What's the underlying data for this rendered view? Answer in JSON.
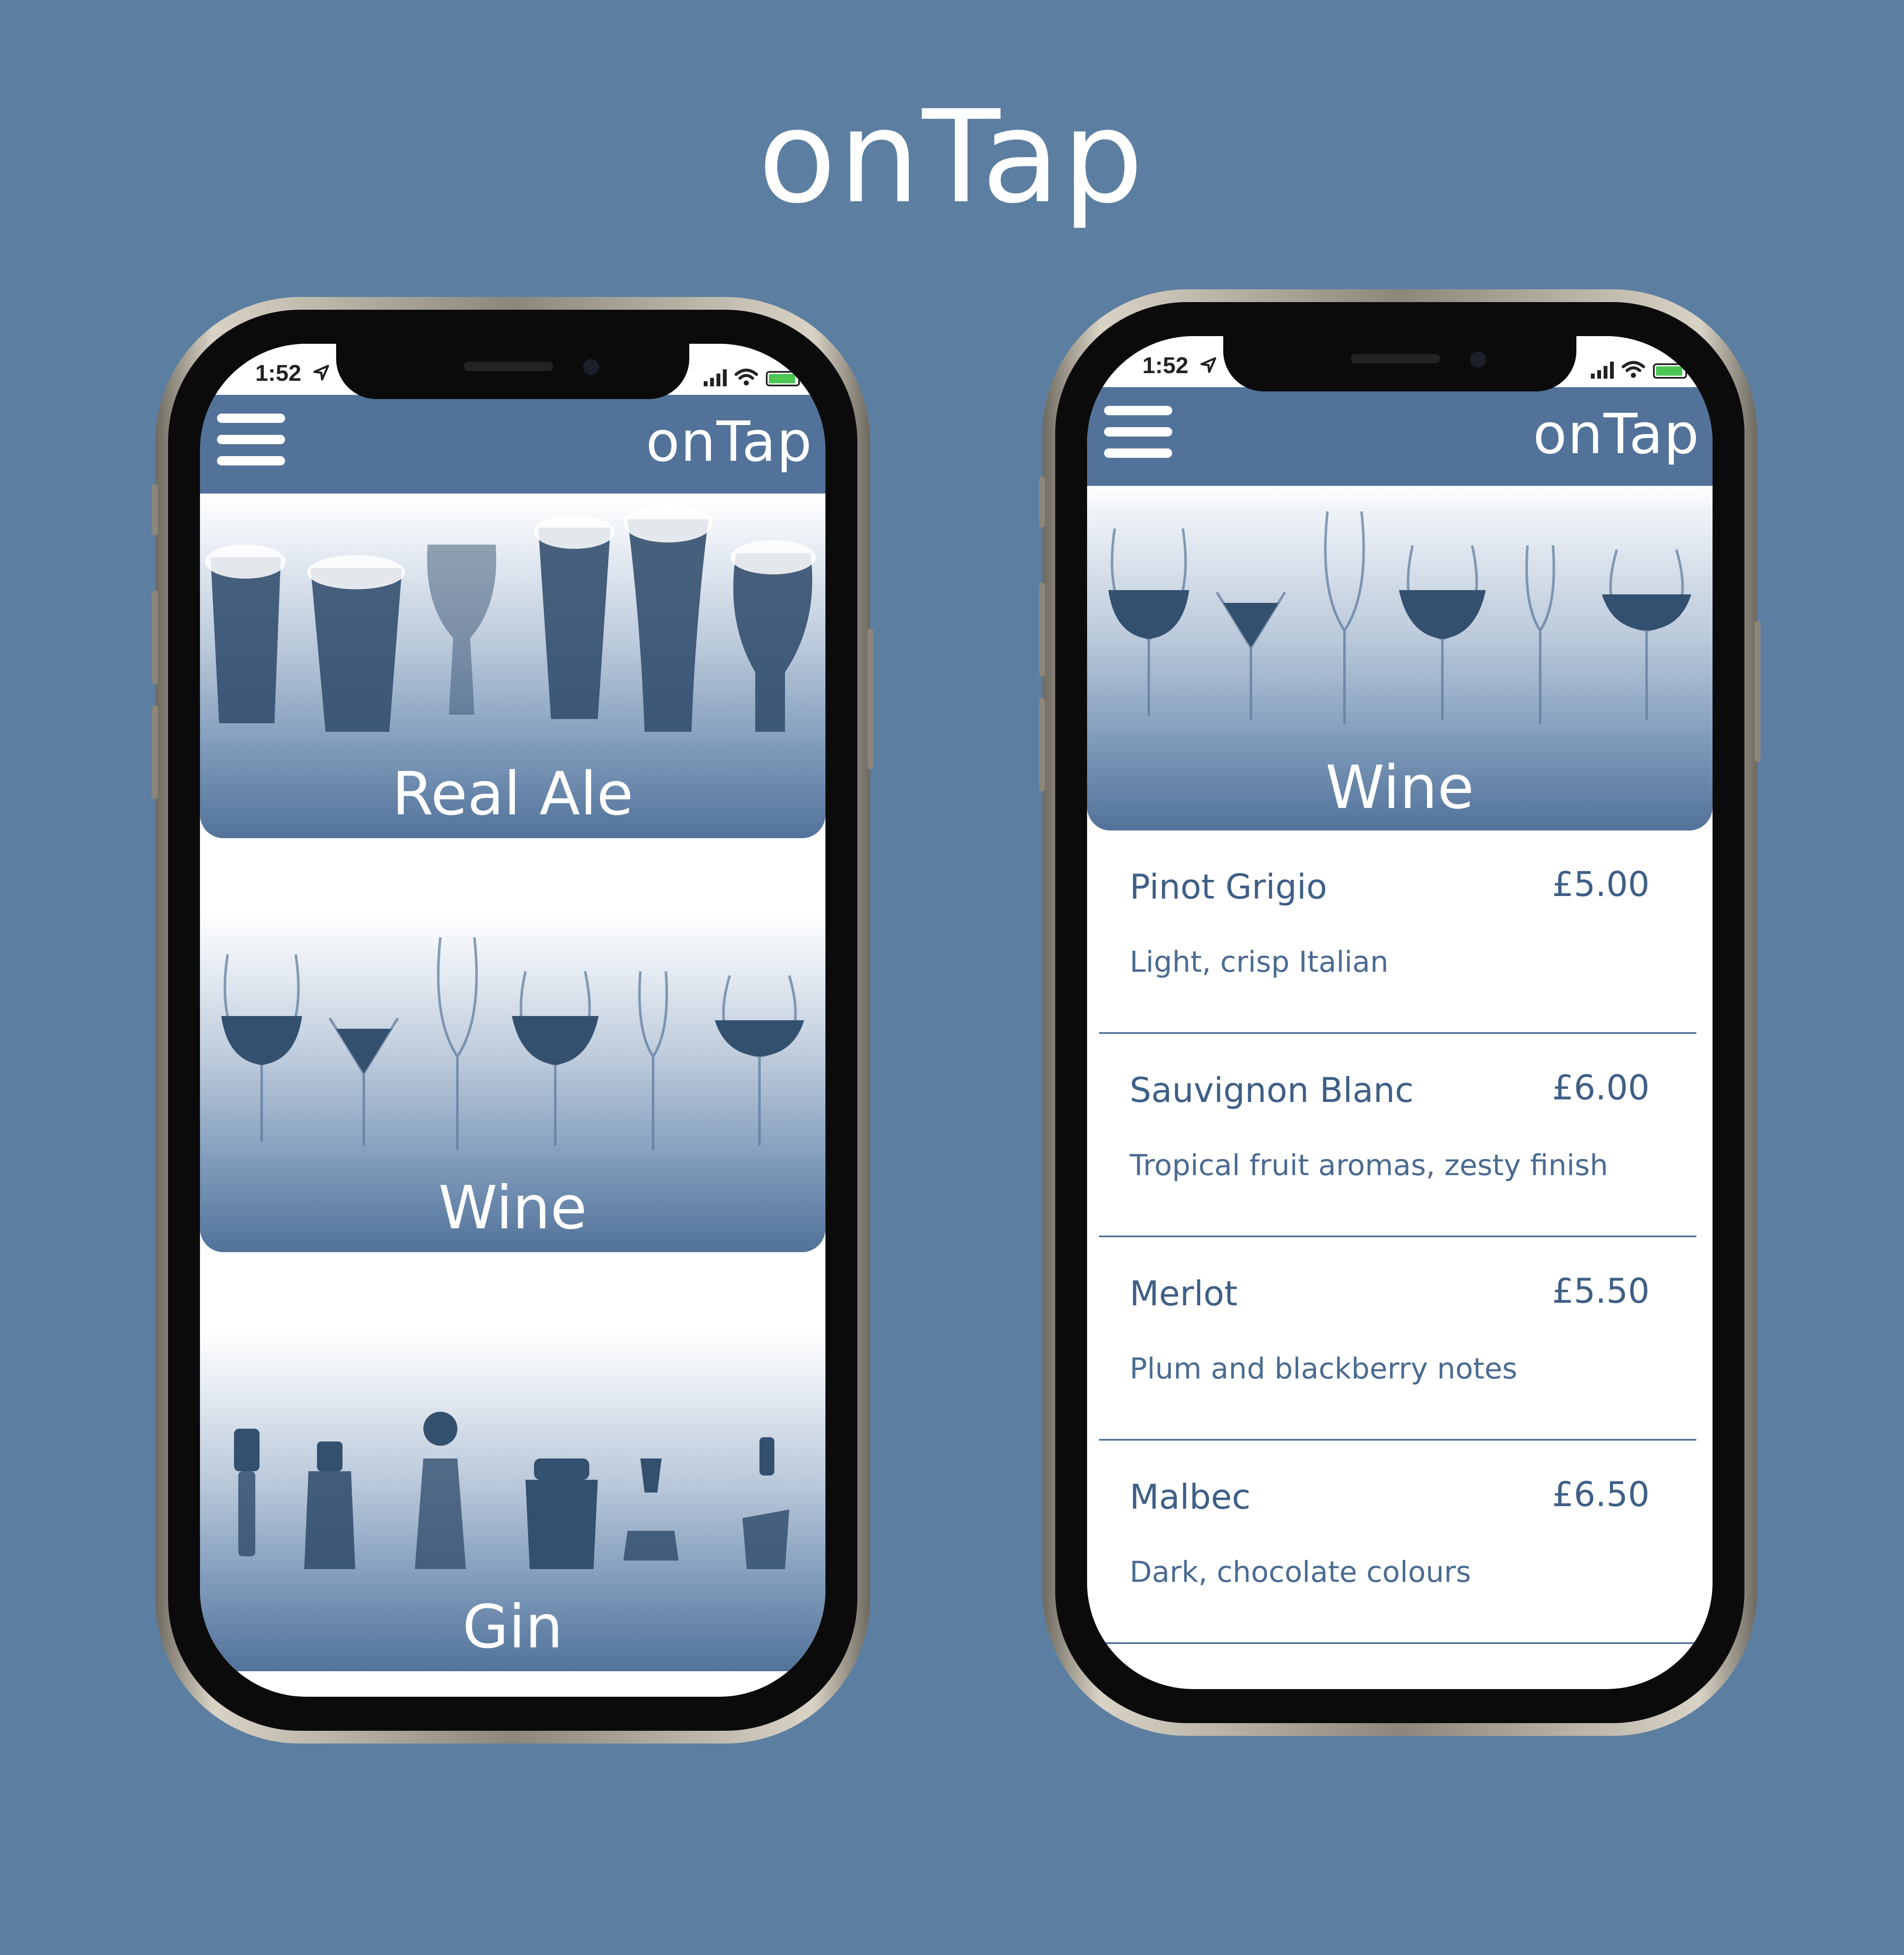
{
  "page": {
    "title": "onTap"
  },
  "status_bar": {
    "time": "1:52"
  },
  "left_phone": {
    "header_logo": "onTap",
    "categories": [
      {
        "label": "Real Ale"
      },
      {
        "label": "Wine"
      },
      {
        "label": "Gin"
      }
    ]
  },
  "right_phone": {
    "header_logo": "onTap",
    "hero_label": "Wine",
    "wines": [
      {
        "name": "Pinot Grigio",
        "price": "£5.00",
        "description": "Light, crisp Italian"
      },
      {
        "name": "Sauvignon Blanc",
        "price": "£6.00",
        "description": "Tropical fruit aromas, zesty finish"
      },
      {
        "name": "Merlot",
        "price": "£5.50",
        "description": "Plum and blackberry notes"
      },
      {
        "name": "Malbec",
        "price": "£6.50",
        "description": "Dark, chocolate colours"
      }
    ]
  },
  "icons": [
    "hamburger-menu-icon",
    "location-arrow-icon",
    "signal-icon",
    "wifi-icon",
    "battery-icon"
  ],
  "colors": {
    "background": "#5c7fa1",
    "header": "#52729a",
    "text_primary": "#3f5f86",
    "white": "#ffffff"
  }
}
